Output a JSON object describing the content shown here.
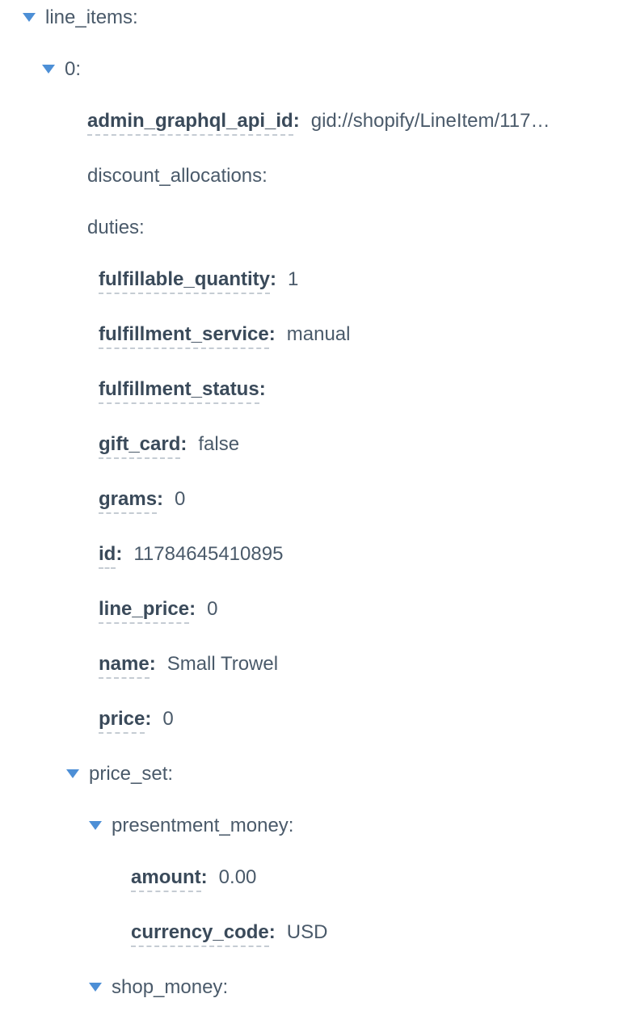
{
  "tree": {
    "line_items": {
      "key": "line_items",
      "children": {
        "idx0": {
          "key": "0",
          "fields": {
            "admin_graphql_api_id": {
              "key": "admin_graphql_api_id",
              "value": "gid://shopify/LineItem/117…"
            },
            "discount_allocations": {
              "key": "discount_allocations",
              "value": ""
            },
            "duties": {
              "key": "duties",
              "value": ""
            },
            "fulfillable_quantity": {
              "key": "fulfillable_quantity",
              "value": "1"
            },
            "fulfillment_service": {
              "key": "fulfillment_service",
              "value": "manual"
            },
            "fulfillment_status": {
              "key": "fulfillment_status",
              "value": ""
            },
            "gift_card": {
              "key": "gift_card",
              "value": "false"
            },
            "grams": {
              "key": "grams",
              "value": "0"
            },
            "id": {
              "key": "id",
              "value": "11784645410895"
            },
            "line_price": {
              "key": "line_price",
              "value": "0"
            },
            "name": {
              "key": "name",
              "value": "Small Trowel"
            },
            "price": {
              "key": "price",
              "value": "0"
            }
          },
          "price_set": {
            "key": "price_set",
            "presentment_money": {
              "key": "presentment_money",
              "amount": {
                "key": "amount",
                "value": "0.00"
              },
              "currency_code": {
                "key": "currency_code",
                "value": "USD"
              }
            },
            "shop_money": {
              "key": "shop_money"
            }
          }
        }
      }
    }
  }
}
